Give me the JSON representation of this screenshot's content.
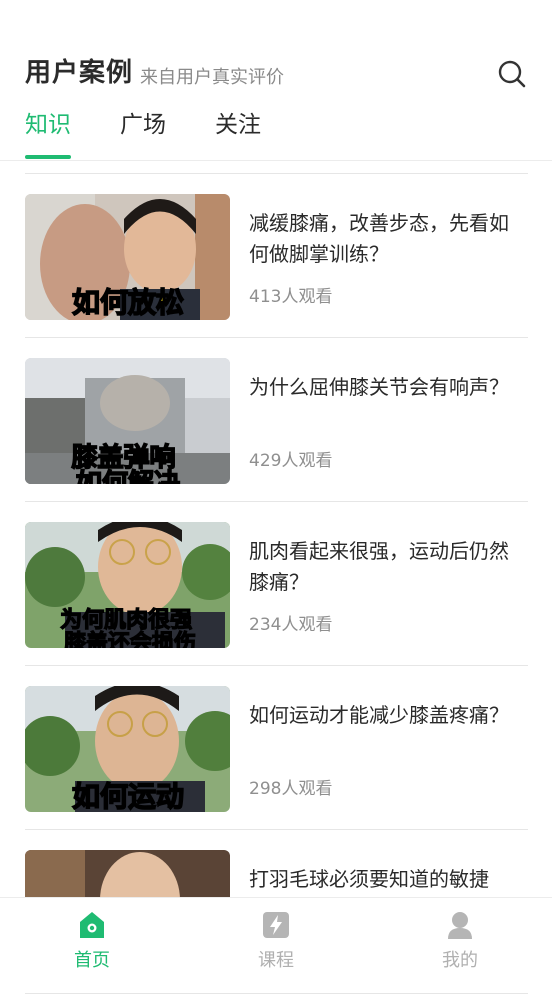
{
  "header": {
    "title": "用户案例",
    "subtitle": "来自用户真实评价",
    "search_icon": "search-icon"
  },
  "tabs": [
    {
      "label": "知识",
      "active": true
    },
    {
      "label": "广场",
      "active": false
    },
    {
      "label": "关注",
      "active": false
    }
  ],
  "items": [
    {
      "title": "减缓膝痛，改善步态，先看如何做脚掌训练？",
      "views": "413人观看",
      "thumb_caption": "如何放松"
    },
    {
      "title": "为什么屈伸膝关节会有响声？",
      "views": "429人观看",
      "thumb_caption": "膝盖弹响\n如何解决"
    },
    {
      "title": "肌肉看起来很强，运动后仍然膝痛？",
      "views": "234人观看",
      "thumb_caption": "为何肌肉很强\n膝盖还会损伤"
    },
    {
      "title": "如何运动才能减少膝盖疼痛？",
      "views": "298人观看",
      "thumb_caption": "如何运动"
    },
    {
      "title": "打羽毛球必须要知道的敏捷",
      "views": "",
      "thumb_caption": ""
    }
  ],
  "bottom_nav": [
    {
      "label": "首页",
      "icon": "home-icon",
      "active": true
    },
    {
      "label": "课程",
      "icon": "course-icon",
      "active": false
    },
    {
      "label": "我的",
      "icon": "profile-icon",
      "active": false
    }
  ],
  "colors": {
    "accent": "#1fbb72",
    "caption_yellow": "#ffe11a"
  }
}
